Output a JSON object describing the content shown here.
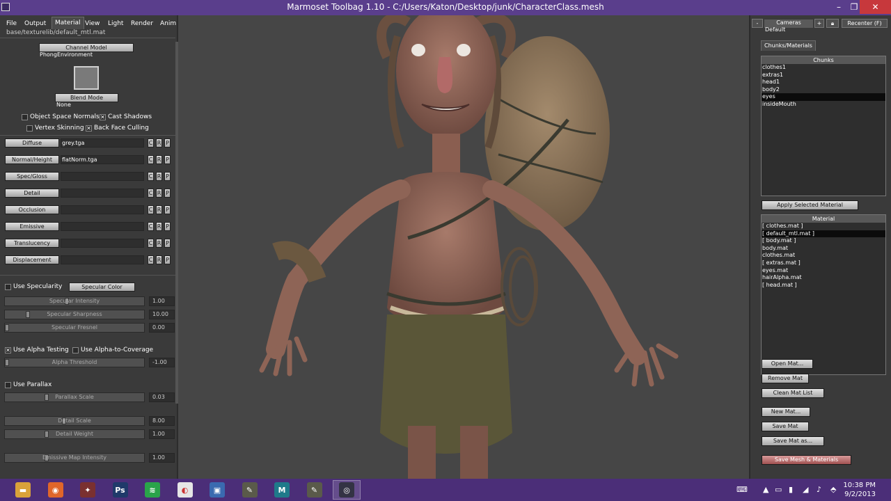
{
  "window": {
    "title": "Marmoset Toolbag 1.10 - C:/Users/Katon/Desktop/junk/CharacterClass.mesh",
    "minimize": "–",
    "maximize": "❐",
    "close": "✕"
  },
  "menu": {
    "items": [
      "File",
      "Output",
      "Material",
      "View",
      "Light",
      "Render",
      "Anim"
    ],
    "active": "Material"
  },
  "material_path": "base/texturelib/default_mtl.mat",
  "channel_model": {
    "label": "Channel Model",
    "value": "PhongEnvironment"
  },
  "blend_mode": {
    "label": "Blend Mode",
    "value": "None"
  },
  "checkboxes": {
    "object_space_normals": {
      "label": "Object Space Normals",
      "checked": false
    },
    "cast_shadows": {
      "label": "Cast Shadows",
      "checked": true
    },
    "vertex_skinning": {
      "label": "Vertex Skinning",
      "checked": false
    },
    "back_face_culling": {
      "label": "Back Face Culling",
      "checked": true
    },
    "use_specularity": {
      "label": "Use Specularity",
      "checked": false
    },
    "use_alpha_testing": {
      "label": "Use Alpha Testing",
      "checked": true
    },
    "use_alpha_to_coverage": {
      "label": "Use Alpha-to-Coverage",
      "checked": false
    },
    "use_parallax": {
      "label": "Use Parallax",
      "checked": false
    }
  },
  "check_mark": "✕",
  "texture_slots": [
    {
      "label": "Diffuse",
      "file": "grey.tga"
    },
    {
      "label": "Normal/Height",
      "file": "flatNorm.tga"
    },
    {
      "label": "Spec/Gloss",
      "file": ""
    },
    {
      "label": "Detail",
      "file": ""
    },
    {
      "label": "Occlusion",
      "file": ""
    },
    {
      "label": "Emissive",
      "file": ""
    },
    {
      "label": "Translucency",
      "file": ""
    },
    {
      "label": "Displacement",
      "file": ""
    }
  ],
  "slot_buttons": [
    "C",
    "R",
    "P"
  ],
  "specular_color_label": "Specular Color",
  "sliders": {
    "specular_intensity": {
      "label": "Specular Intensity",
      "value": "1.00",
      "level": 0.45
    },
    "specular_sharpness": {
      "label": "Specular Sharpness",
      "value": "10.00",
      "level": 0.16
    },
    "specular_fresnel": {
      "label": "Specular Fresnel",
      "value": "0.00",
      "level": 0.0
    },
    "alpha_threshold": {
      "label": "Alpha Threshold",
      "value": "-1.00",
      "level": 0.0
    },
    "parallax_scale": {
      "label": "Parallax Scale",
      "value": "0.03",
      "level": 0.3
    },
    "detail_scale": {
      "label": "Detail Scale",
      "value": "8.00",
      "level": 0.43
    },
    "detail_weight": {
      "label": "Detail Weight",
      "value": "1.00",
      "level": 0.3
    },
    "emissive_map_intensity": {
      "label": "Emissive Map Intensity",
      "value": "1.00",
      "level": 0.3
    }
  },
  "right_panel": {
    "cameras_label": "Cameras",
    "camera_value": "Default",
    "minus": "-",
    "plus": "+",
    "recenter": "Recenter (F)",
    "tab": "Chunks/Materials",
    "chunks_header": "Chunks",
    "chunks": [
      "clothes1",
      "extras1",
      "head1",
      "body2",
      "eyes",
      "insideMouth"
    ],
    "selected_chunk": "eyes",
    "apply_button": "Apply Selected Material",
    "material_header": "Material",
    "materials": [
      "[ clothes.mat ]",
      "[ default_mtl.mat ]",
      "[ body.mat ]",
      "body.mat",
      "clothes.mat",
      "[ extras.mat ]",
      "eyes.mat",
      "hairAlpha.mat",
      "[ head.mat ]"
    ],
    "selected_material": "[ default_mtl.mat ]",
    "buttons": {
      "open_mat": "Open Mat...",
      "remove_mat": "Remove Mat",
      "clean_mat_list": "Clean Mat List",
      "new_mat": "New Mat...",
      "save_mat": "Save Mat",
      "save_mat_as": "Save Mat as...",
      "save_mesh_materials": "Save Mesh & Materials"
    }
  },
  "taskbar": {
    "apps": [
      "file-explorer",
      "firefox",
      "settings",
      "photoshop",
      "spotify",
      "chrome",
      "remote-desktop",
      "tool",
      "maya",
      "tool-2",
      "marmoset-toolbag"
    ],
    "app_glyphs": [
      "▬",
      "◉",
      "✦",
      "Ps",
      "≋",
      "◐",
      "▣",
      "✎",
      "M",
      "✎",
      "◎"
    ],
    "clock_time": "10:38 PM",
    "clock_date": "9/2/2013",
    "tray_glyphs": [
      "⌨",
      "▲",
      "▭",
      "▮",
      "◢",
      "♪",
      "⬘"
    ]
  },
  "colors": {
    "title_bar": "#5a3e8c",
    "taskbar": "#4b2e78",
    "panel": "#3a3a3a",
    "viewport": "#464646",
    "close_button": "#c7383c"
  }
}
